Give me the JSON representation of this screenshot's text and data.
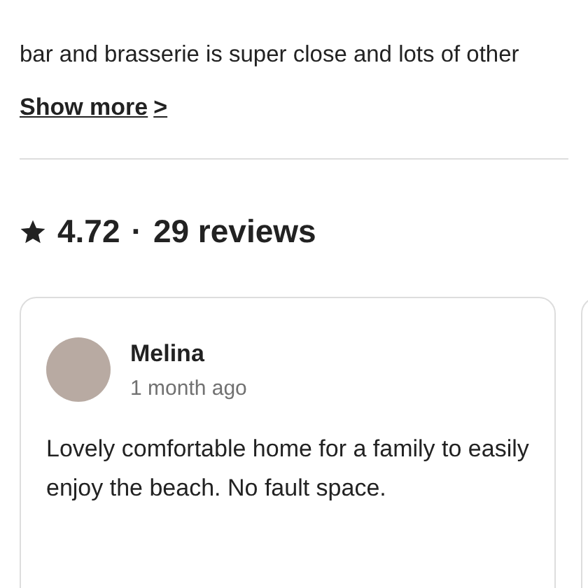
{
  "description": {
    "text": "bar and brasserie is super close and lots of other",
    "show_more": "Show more",
    "show_more_icon": ">"
  },
  "rating": {
    "score": "4.72",
    "separator": "·",
    "count": "29 reviews"
  },
  "reviews": [
    {
      "name": "Melina",
      "date": "1 month ago",
      "text": "Lovely comfortable home for a family to easily enjoy the beach. No fault space."
    }
  ]
}
